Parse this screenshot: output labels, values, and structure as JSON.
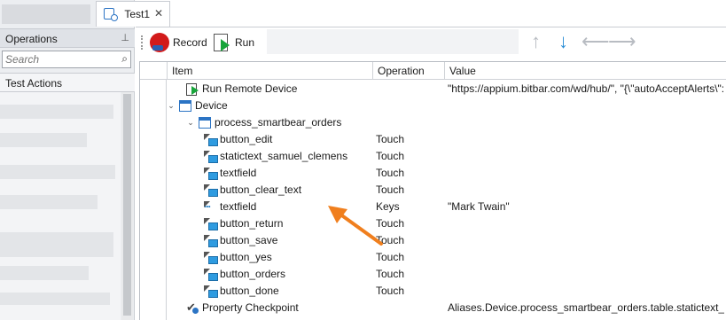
{
  "tab": {
    "title": "Test1",
    "close_glyph": "✕",
    "icon": "test-file-icon"
  },
  "left_panel": {
    "header": "Operations",
    "pin_glyph": "⊥",
    "search_placeholder": "Search",
    "search_glyph": "⌕",
    "section": "Test Actions"
  },
  "toolbar": {
    "record_label": "Record",
    "run_label": "Run",
    "icons": [
      "record-icon",
      "run-icon",
      "move-up-icon",
      "move-down-icon",
      "move-left-icon",
      "move-right-icon"
    ],
    "arrows": {
      "up": "↑",
      "down": "↓",
      "left": "⟵",
      "right": "⟶"
    },
    "accent_down": "#2c8fd6"
  },
  "grid": {
    "columns": [
      "Item",
      "Operation",
      "Value"
    ],
    "rows": [
      {
        "item": "Run Remote Device",
        "operation": "",
        "value": "\"https://appium.bitbar.com/wd/hub/\", \"{\\\"autoAcceptAlerts\\\":f...",
        "icon": "run-icon",
        "expander": ""
      },
      {
        "item": "Device",
        "operation": "",
        "value": "",
        "icon": "window-icon",
        "expander": "⌄"
      },
      {
        "item": "process_smartbear_orders",
        "operation": "",
        "value": "",
        "icon": "window-icon",
        "expander": "⌄"
      },
      {
        "item": "button_edit",
        "operation": "Touch",
        "value": "",
        "icon": "touch-icon",
        "expander": ""
      },
      {
        "item": "statictext_samuel_clemens",
        "operation": "Touch",
        "value": "",
        "icon": "touch-icon",
        "expander": ""
      },
      {
        "item": "textfield",
        "operation": "Touch",
        "value": "",
        "icon": "touch-icon",
        "expander": ""
      },
      {
        "item": "button_clear_text",
        "operation": "Touch",
        "value": "",
        "icon": "touch-icon",
        "expander": ""
      },
      {
        "item": "textfield",
        "operation": "Keys",
        "value": "\"Mark Twain\"",
        "icon": "keys-icon",
        "expander": ""
      },
      {
        "item": "button_return",
        "operation": "Touch",
        "value": "",
        "icon": "touch-icon",
        "expander": ""
      },
      {
        "item": "button_save",
        "operation": "Touch",
        "value": "",
        "icon": "touch-icon",
        "expander": ""
      },
      {
        "item": "button_yes",
        "operation": "Touch",
        "value": "",
        "icon": "touch-icon",
        "expander": ""
      },
      {
        "item": "button_orders",
        "operation": "Touch",
        "value": "",
        "icon": "touch-icon",
        "expander": ""
      },
      {
        "item": "button_done",
        "operation": "Touch",
        "value": "",
        "icon": "touch-icon",
        "expander": ""
      },
      {
        "item": "Property Checkpoint",
        "operation": "",
        "value": "Aliases.Device.process_smartbear_orders.table.statictext_ma...",
        "icon": "checkpoint-icon",
        "expander": ""
      }
    ]
  },
  "annotation": {
    "color": "#f07f1e",
    "icon": "orange-arrow-icon"
  }
}
